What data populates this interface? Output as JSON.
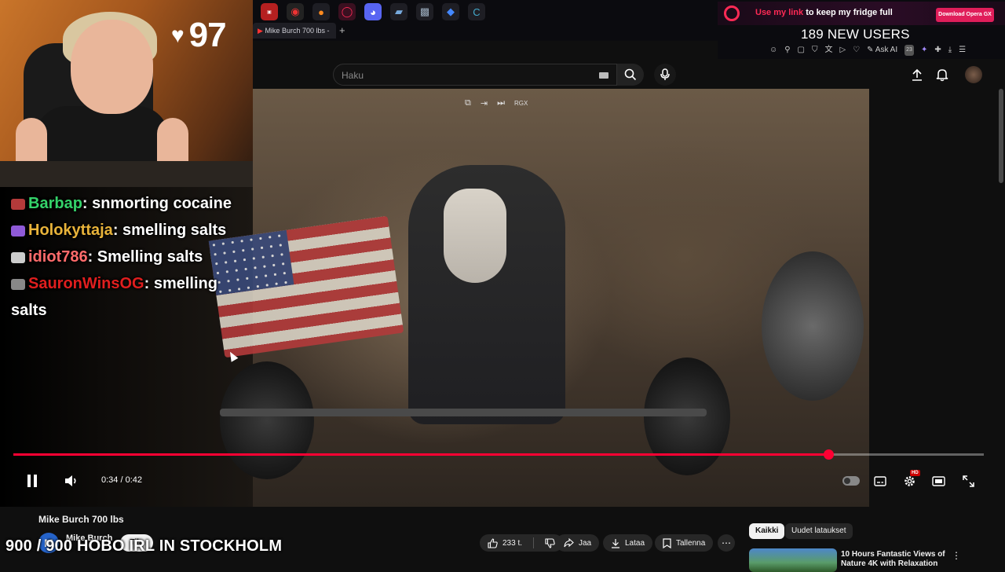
{
  "stream": {
    "heart_icon": "heart-icon",
    "viewer_count": "97",
    "chat": [
      {
        "user": "Barbap",
        "color": "#34d36a",
        "badge_color": "#b43a3a",
        "message": "snmorting cocaine"
      },
      {
        "user": "Holokyttaja",
        "color": "#e8b33a",
        "badge_color": "#8f5ad8",
        "message": "smelling salts"
      },
      {
        "user": "idiot786",
        "color": "#ff6b6b",
        "badge_color": "#cccccc",
        "message": "Smelling salts"
      },
      {
        "user": "SauronWinsOG",
        "color": "#e01e1e",
        "badge_color": "#888888",
        "message": "smelling salts"
      }
    ],
    "overlay_text": "900 / 900 HOBO IRL IN STOCKHOLM"
  },
  "browser": {
    "tab_title": "Mike Burch 700 lbs -",
    "new_tab": "+",
    "ad": {
      "text_highlight": "Use my link",
      "text_rest": " to keep my fridge full",
      "button": "Download Opera GX",
      "new_users": "189 NEW USERS"
    },
    "ask_ai": "Ask AI",
    "notif_count": "23"
  },
  "youtube": {
    "search_placeholder": "Haku",
    "overlay_label": "RGX",
    "player": {
      "time": "0:34 / 0:42",
      "progress_fraction": 0.84,
      "hd_label": "HD"
    },
    "video_title": "Mike Burch 700 lbs",
    "channel": {
      "name": "Mike Burch",
      "avatar_letter": "M",
      "subscribe": "Tila"
    },
    "actions": {
      "likes": "233 t.",
      "share": "Jaa",
      "download": "Lataa",
      "save": "Tallenna"
    },
    "chips": [
      "Kaikki",
      "Uudet lataukset"
    ],
    "recommended": {
      "title": "10 Hours Fantastic Views of Nature 4K with Relaxation"
    }
  }
}
